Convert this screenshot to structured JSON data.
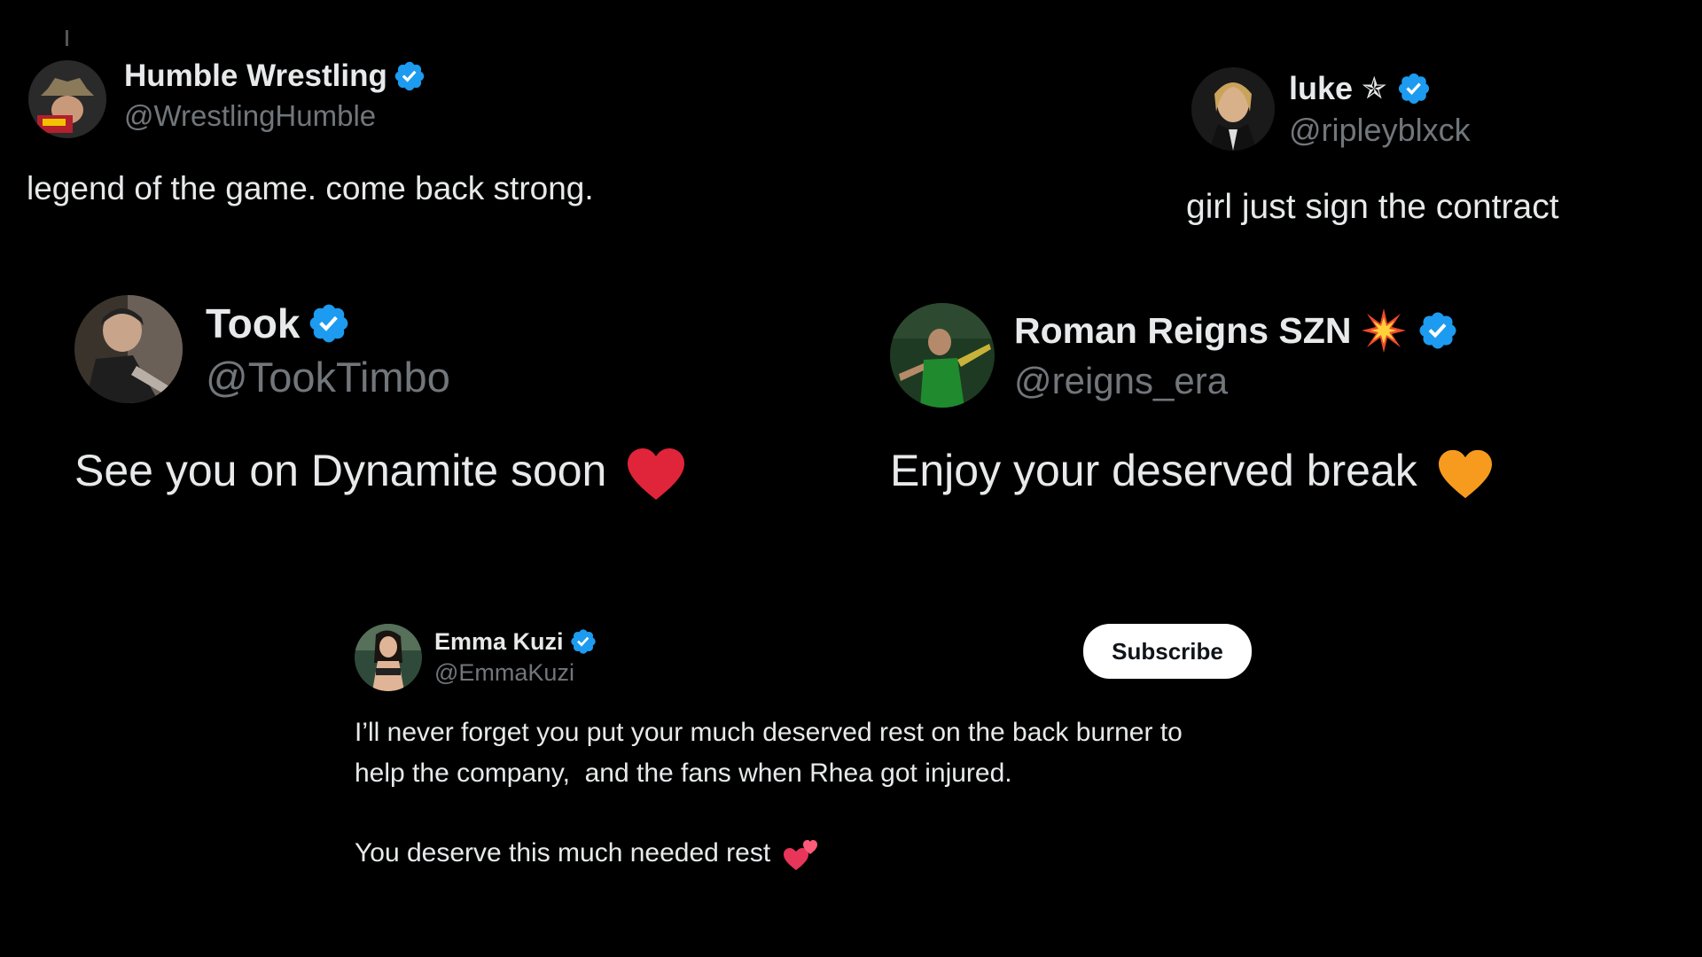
{
  "tweets": [
    {
      "name": "Humble Wrestling",
      "handle": "@WrestlingHumble",
      "text": "legend of the game. come back strong.",
      "verified": true
    },
    {
      "name": "luke",
      "handle": "@ripleyblxck",
      "text": "girl just sign the contract",
      "verified": true,
      "name_symbol": "✯"
    },
    {
      "name": "Took",
      "handle": "@TookTimbo",
      "text": "See you on Dynamite soon",
      "verified": true,
      "emoji": "red-heart-icon"
    },
    {
      "name": "Roman Reigns SZN",
      "handle": "@reigns_era",
      "text": "Enjoy your deserved break",
      "verified": true,
      "name_emoji": "collision-icon",
      "emoji": "orange-heart-icon"
    },
    {
      "name": "Emma Kuzi",
      "handle": "@EmmaKuzi",
      "text_line1": "I’ll never forget you put your much deserved rest on the back burner to",
      "text_line2": "help the company,  and the fans when Rhea got injured.",
      "text_line3": "You deserve this much needed rest",
      "verified": true,
      "emoji": "two-hearts-icon",
      "subscribe_label": "Subscribe"
    }
  ],
  "colors": {
    "background": "#000000",
    "text": "#e7e9ea",
    "handle": "#71767b",
    "verified": "#1d9bf0"
  }
}
